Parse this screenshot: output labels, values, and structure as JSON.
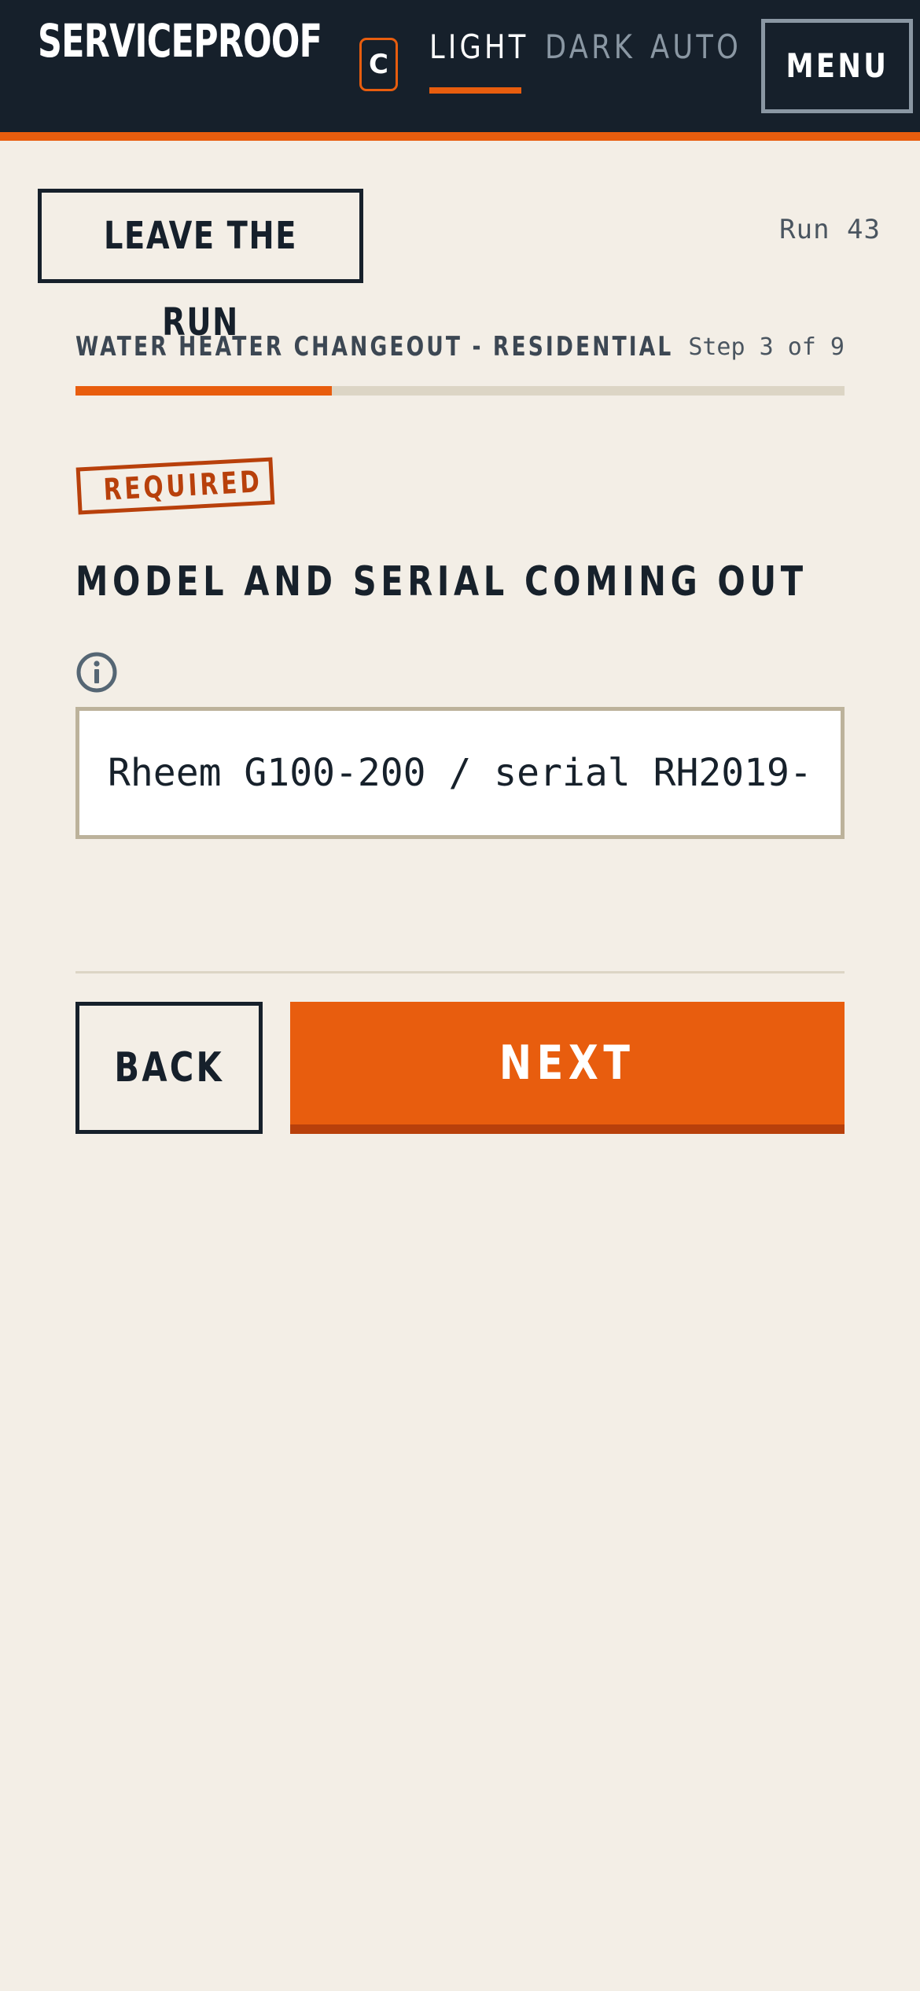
{
  "header": {
    "brand": "SERVICEPROOF",
    "mode_chip": "C",
    "theme_tabs": [
      {
        "label": "LIGHT",
        "active": true
      },
      {
        "label": "DARK",
        "active": false
      },
      {
        "label": "AUTO",
        "active": false
      }
    ],
    "menu_label": "MENU"
  },
  "run": {
    "leave_label": "LEAVE THE RUN",
    "run_label": "Run 43"
  },
  "procedure": {
    "title": "WATER HEATER CHANGEOUT - RESIDENTIAL",
    "step_label": "Step 3 of 9",
    "progress_fraction": 0.333
  },
  "field": {
    "required_label": "REQUIRED",
    "label": "MODEL AND SERIAL COMING OUT",
    "value": "Rheem G100-200 / serial RH2019-"
  },
  "nav": {
    "back_label": "BACK",
    "next_label": "NEXT"
  },
  "colors": {
    "accent": "#e85d0e",
    "accent_dark": "#b8400b",
    "header_bg": "#16202b",
    "page_bg": "#f3eee6"
  },
  "icons": {
    "info": "info-circle-icon"
  }
}
